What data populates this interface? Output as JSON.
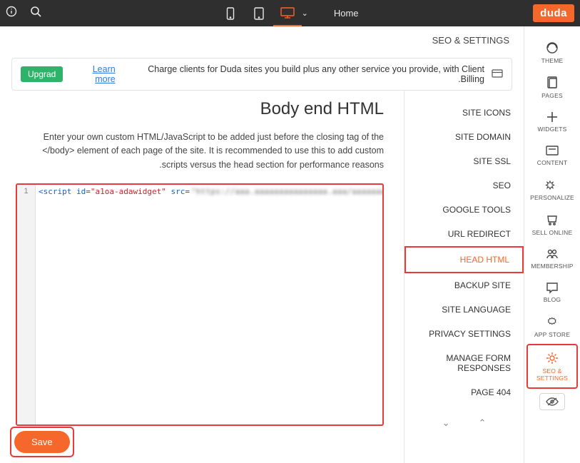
{
  "topbar": {
    "logo": "duda",
    "home": "Home"
  },
  "rail": {
    "theme": "THEME",
    "pages": "PAGES",
    "widgets": "WIDGETS",
    "content": "CONTENT",
    "personalize": "PERSONALIZE",
    "sell": "SELL ONLINE",
    "membership": "MEMBERSHIP",
    "blog": "BLOG",
    "appstore": "APP STORE",
    "seo": "SEO & SETTINGS"
  },
  "crumb": "SEO & SETTINGS",
  "banner": {
    "text": "Charge clients for Duda sites you build plus any other service you provide, with Client Billing.",
    "link": "Learn more",
    "upgrade": "Upgrad"
  },
  "menu": {
    "items": [
      "SITE ICONS",
      "SITE DOMAIN",
      "SITE SSL",
      "SEO",
      "GOOGLE TOOLS",
      "URL REDIRECT",
      "HEAD HTML",
      "BACKUP SITE",
      "SITE LANGUAGE",
      "PRIVACY SETTINGS",
      "MANAGE FORM RESPONSES",
      "404 PAGE"
    ]
  },
  "page": {
    "title": "Body end HTML",
    "desc": "Enter your own custom HTML/JavaScript to be added just before the closing tag of the </body> element of each page of the site. It is recommended to use this to add custom scripts versus the head section for performance reasons.",
    "code_lineno": "1",
    "code_prefix": "<script id=",
    "code_idval": "\"a1oa-adawidget\"",
    "code_srcattr": " src=",
    "save": "Save"
  }
}
